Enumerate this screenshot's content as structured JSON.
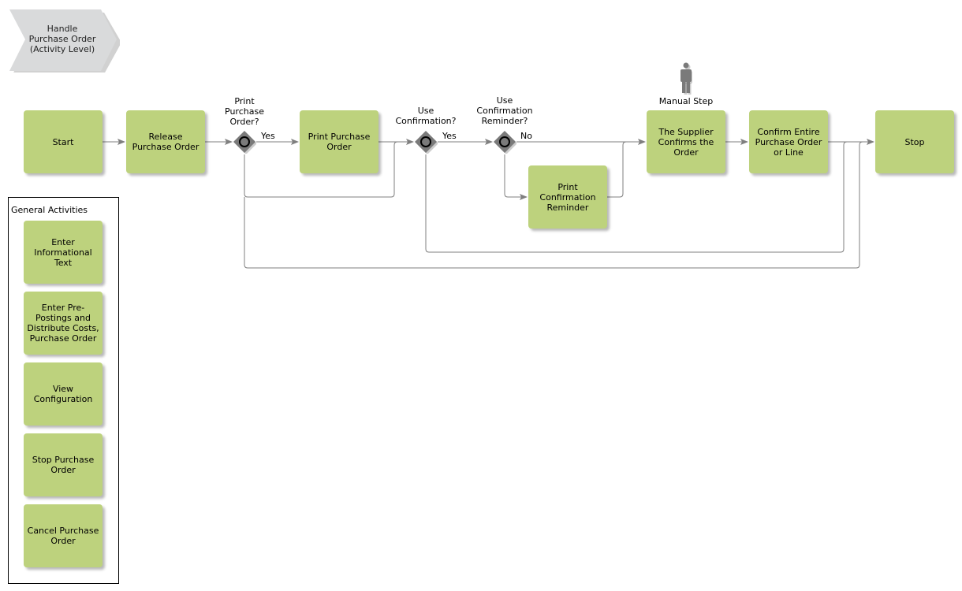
{
  "title": "Handle\nPurchase Order\n(Activity Level)",
  "colors": {
    "activity_fill": "#bdd27d",
    "gateway_fill": "#7a7a7a",
    "connector": "#7f7f7f",
    "title_fill": "#d9dadb",
    "person": "#7a7a7a"
  },
  "activities": {
    "start": "Start",
    "release": "Release\nPurchase Order",
    "print_po": "Print Purchase\nOrder",
    "print_reminder": "Print\nConfirmation\nReminder",
    "supplier_confirms": "The Supplier\nConfirms the\nOrder",
    "confirm_entire": "Confirm Entire\nPurchase Order\nor Line",
    "stop": "Stop"
  },
  "gateways": {
    "print_po_q": "Print\nPurchase\nOrder?",
    "use_confirmation_q": "Use\nConfirmation?",
    "use_reminder_q": "Use\nConfirmation\nReminder?"
  },
  "edge_labels": {
    "yes1": "Yes",
    "yes2": "Yes",
    "no": "No"
  },
  "manual_step_label": "Manual Step",
  "general_activities": {
    "title": "General Activities",
    "items": [
      "Enter\nInformational\nText",
      "Enter Pre-\nPostings and\nDistribute Costs,\nPurchase Order",
      "View\nConfiguration",
      "Stop Purchase\nOrder",
      "Cancel Purchase\nOrder"
    ]
  }
}
